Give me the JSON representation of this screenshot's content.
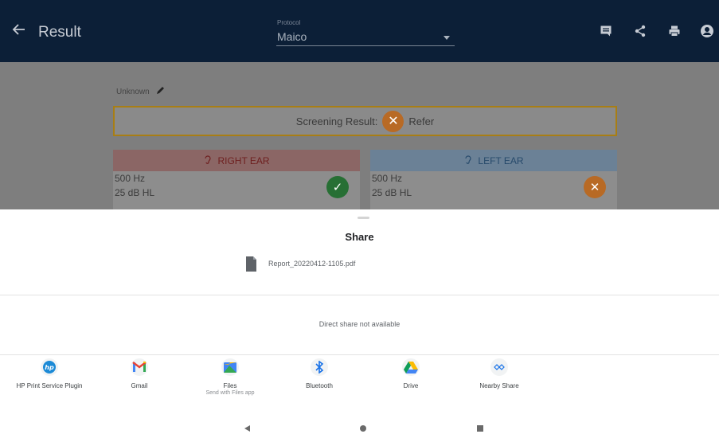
{
  "appbar": {
    "title": "Result",
    "protocol_label": "Protocol",
    "protocol_value": "Maico",
    "icons": [
      "back-arrow-icon",
      "comment-icon",
      "share-icon",
      "print-icon",
      "account-icon"
    ]
  },
  "content": {
    "patient_name": "Unknown",
    "screening_label": "Screening Result:",
    "screening_value": "Refer",
    "right_ear": {
      "title": "RIGHT EAR",
      "freq": "500 Hz",
      "db": "25 dB HL",
      "status_icon": "check-icon"
    },
    "left_ear": {
      "title": "LEFT EAR",
      "freq": "500 Hz",
      "db": "25 dB HL",
      "status_icon": "close-icon"
    }
  },
  "share_sheet": {
    "title": "Share",
    "file_name": "Report_20220412-1105.pdf",
    "direct_share": "Direct share not available",
    "targets": [
      {
        "label": "HP Print Service Plugin",
        "sub": "",
        "icon": "hp-icon"
      },
      {
        "label": "Gmail",
        "sub": "",
        "icon": "gmail-icon"
      },
      {
        "label": "Files",
        "sub": "Send with Files app",
        "icon": "files-icon"
      },
      {
        "label": "Bluetooth",
        "sub": "",
        "icon": "bluetooth-icon"
      },
      {
        "label": "Drive",
        "sub": "",
        "icon": "drive-icon"
      },
      {
        "label": "Nearby Share",
        "sub": "",
        "icon": "nearby-share-icon"
      }
    ]
  },
  "colors": {
    "appbar": "#0c1f37",
    "refer": "#e8862e",
    "pass": "#3aaa4c"
  }
}
